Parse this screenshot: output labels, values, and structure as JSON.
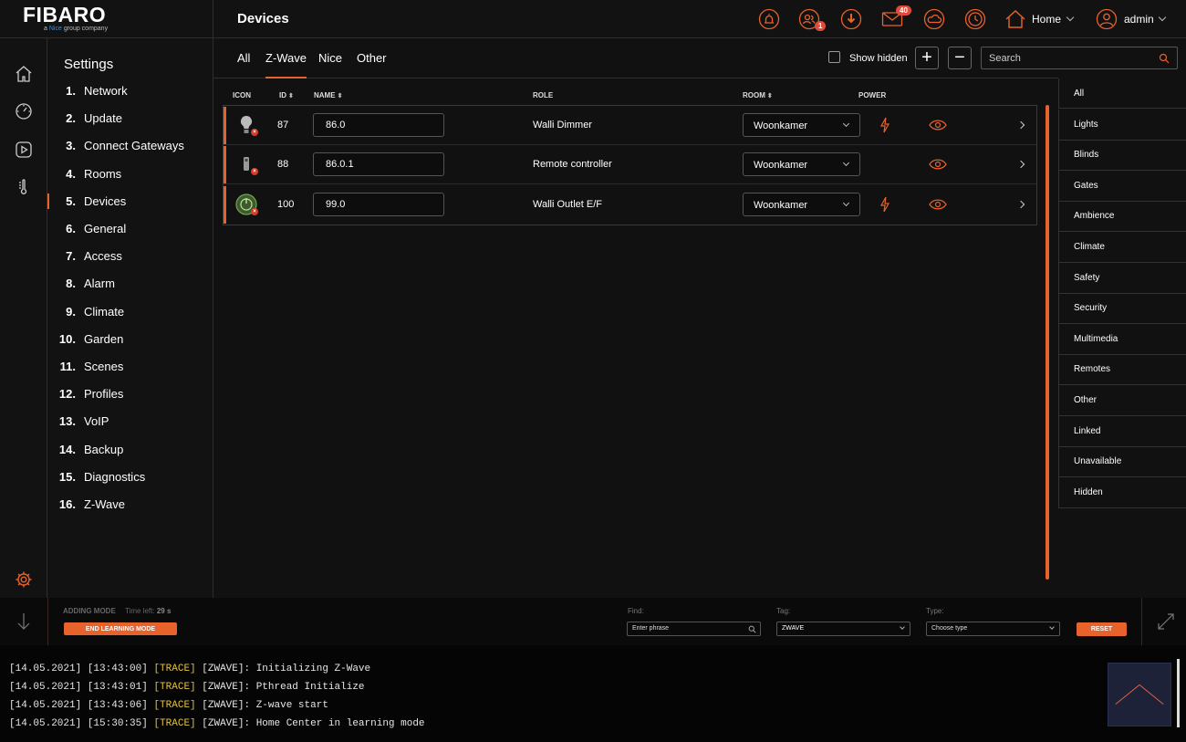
{
  "brand": {
    "name": "FIBARO",
    "tagline_prefix": "a",
    "tagline_brand": "Nice",
    "tagline_suffix": "group company"
  },
  "header": {
    "title": "Devices",
    "users_badge": "1",
    "messages_badge": "40",
    "home_label": "Home",
    "user_label": "admin",
    "accent": "#e8622c"
  },
  "settings": {
    "title": "Settings",
    "items": [
      {
        "num": "1.",
        "label": "Network"
      },
      {
        "num": "2.",
        "label": "Update"
      },
      {
        "num": "3.",
        "label": "Connect Gateways"
      },
      {
        "num": "4.",
        "label": "Rooms"
      },
      {
        "num": "5.",
        "label": "Devices"
      },
      {
        "num": "6.",
        "label": "General"
      },
      {
        "num": "7.",
        "label": "Access"
      },
      {
        "num": "8.",
        "label": "Alarm"
      },
      {
        "num": "9.",
        "label": "Climate"
      },
      {
        "num": "10.",
        "label": "Garden"
      },
      {
        "num": "11.",
        "label": "Scenes"
      },
      {
        "num": "12.",
        "label": "Profiles"
      },
      {
        "num": "13.",
        "label": "VoIP"
      },
      {
        "num": "14.",
        "label": "Backup"
      },
      {
        "num": "15.",
        "label": "Diagnostics"
      },
      {
        "num": "16.",
        "label": "Z-Wave"
      }
    ]
  },
  "tabs": [
    "All",
    "Z-Wave",
    "Nice",
    "Other"
  ],
  "toolbar": {
    "show_hidden": "Show hidden",
    "add": "+",
    "remove": "−",
    "search_placeholder": "Search"
  },
  "table": {
    "headers": {
      "icon": "ICON",
      "id": "ID",
      "name": "NAME",
      "role": "ROLE",
      "room": "ROOM",
      "power": "POWER"
    },
    "rows": [
      {
        "id": "87",
        "name": "86.0",
        "role": "Walli Dimmer",
        "room": "Woonkamer",
        "icon": "bulb-icon"
      },
      {
        "id": "88",
        "name": "86.0.1",
        "role": "Remote controller",
        "room": "Woonkamer",
        "icon": "remote-icon"
      },
      {
        "id": "100",
        "name": "99.0",
        "role": "Walli Outlet E/F",
        "room": "Woonkamer",
        "icon": "outlet-icon"
      }
    ]
  },
  "categories": [
    "All",
    "Lights",
    "Blinds",
    "Gates",
    "Ambience",
    "Climate",
    "Safety",
    "Security",
    "Multimedia",
    "Remotes",
    "Other",
    "Linked",
    "Unavailable",
    "Hidden"
  ],
  "bottom": {
    "adding_mode": "ADDING MODE",
    "time_left_label": "Time left:",
    "time_left_value": "29 s",
    "end_learning": "END LEARNING MODE",
    "find_label": "Find:",
    "find_placeholder": "Enter phrase",
    "tag_label": "Tag:",
    "tag_value": "ZWAVE",
    "type_label": "Type:",
    "type_value": "Choose type",
    "reset": "RESET"
  },
  "console": [
    {
      "date": "[14.05.2021]",
      "time": "[13:43:00]",
      "level": "[TRACE]",
      "src": "[ZWAVE]:",
      "msg": "Initializing Z-Wave"
    },
    {
      "date": "[14.05.2021]",
      "time": "[13:43:01]",
      "level": "[TRACE]",
      "src": "[ZWAVE]:",
      "msg": "Pthread Initialize"
    },
    {
      "date": "[14.05.2021]",
      "time": "[13:43:06]",
      "level": "[TRACE]",
      "src": "[ZWAVE]:",
      "msg": "Z-wave start"
    },
    {
      "date": "[14.05.2021]",
      "time": "[15:30:35]",
      "level": "[TRACE]",
      "src": "[ZWAVE]:",
      "msg": "Home Center in learning mode"
    }
  ]
}
